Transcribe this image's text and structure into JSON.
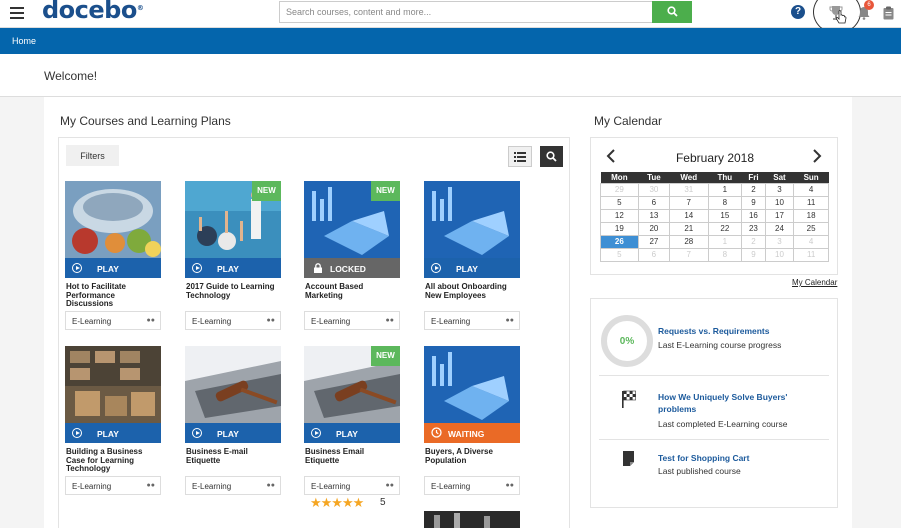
{
  "header": {
    "logo": "docebo",
    "logo_mark": "®",
    "search_placeholder": "Search courses, content and more...",
    "notification_count": "6"
  },
  "breadcrumb": {
    "home": "Home"
  },
  "welcome": "Welcome!",
  "courses": {
    "title": "My Courses and Learning Plans",
    "filters_label": "Filters",
    "items": [
      {
        "title": "Hot to Facilitate Performance Discussions",
        "status": "PLAY",
        "type": "E-Learning",
        "new": false
      },
      {
        "title": "2017 Guide to Learning Technology",
        "status": "PLAY",
        "type": "E-Learning",
        "new": true,
        "badge": "NEW"
      },
      {
        "title": "Account Based Marketing",
        "status": "LOCKED",
        "type": "E-Learning",
        "new": true,
        "badge": "NEW"
      },
      {
        "title": "All about Onboarding New Employees",
        "status": "PLAY",
        "type": "E-Learning",
        "new": false
      },
      {
        "title": "Building a Business Case for Learning Technology",
        "status": "PLAY",
        "type": "E-Learning",
        "new": false
      },
      {
        "title": "Business E-mail Etiquette",
        "status": "PLAY",
        "type": "E-Learning",
        "new": false
      },
      {
        "title": "Business Email Etiquette",
        "status": "PLAY",
        "type": "E-Learning",
        "new": true,
        "badge": "NEW",
        "rating": "★★★★★",
        "rating_count": "5"
      },
      {
        "title": "Buyers, A Diverse Population",
        "status": "WAITING",
        "type": "E-Learning",
        "new": false
      }
    ]
  },
  "calendar": {
    "title": "My Calendar",
    "month": "February 2018",
    "weekdays": [
      "Mon",
      "Tue",
      "Wed",
      "Thu",
      "Fri",
      "Sat",
      "Sun"
    ],
    "weeks": [
      [
        "29",
        "30",
        "31",
        "1",
        "2",
        "3",
        "4"
      ],
      [
        "5",
        "6",
        "7",
        "8",
        "9",
        "10",
        "11"
      ],
      [
        "12",
        "13",
        "14",
        "15",
        "16",
        "17",
        "18"
      ],
      [
        "19",
        "20",
        "21",
        "22",
        "23",
        "24",
        "25"
      ],
      [
        "26",
        "27",
        "28",
        "1",
        "2",
        "3",
        "4"
      ],
      [
        "5",
        "6",
        "7",
        "8",
        "9",
        "10",
        "11"
      ]
    ],
    "link": "My Calendar"
  },
  "reports": {
    "progress": "0%",
    "items": [
      {
        "title": "Requests vs. Requirements",
        "subtitle": "Last E-Learning course progress"
      },
      {
        "title": "How We Uniquely Solve Buyers' problems",
        "subtitle": "Last completed E-Learning course"
      },
      {
        "title": "Test for Shopping Cart",
        "subtitle": "Last published course"
      }
    ]
  },
  "colors": {
    "brand": "#1b4f8c",
    "bar": "#0465ac",
    "play": "#1c62ac",
    "locked": "#666666",
    "waiting": "#ea6a26",
    "new": "#5cb85c"
  }
}
